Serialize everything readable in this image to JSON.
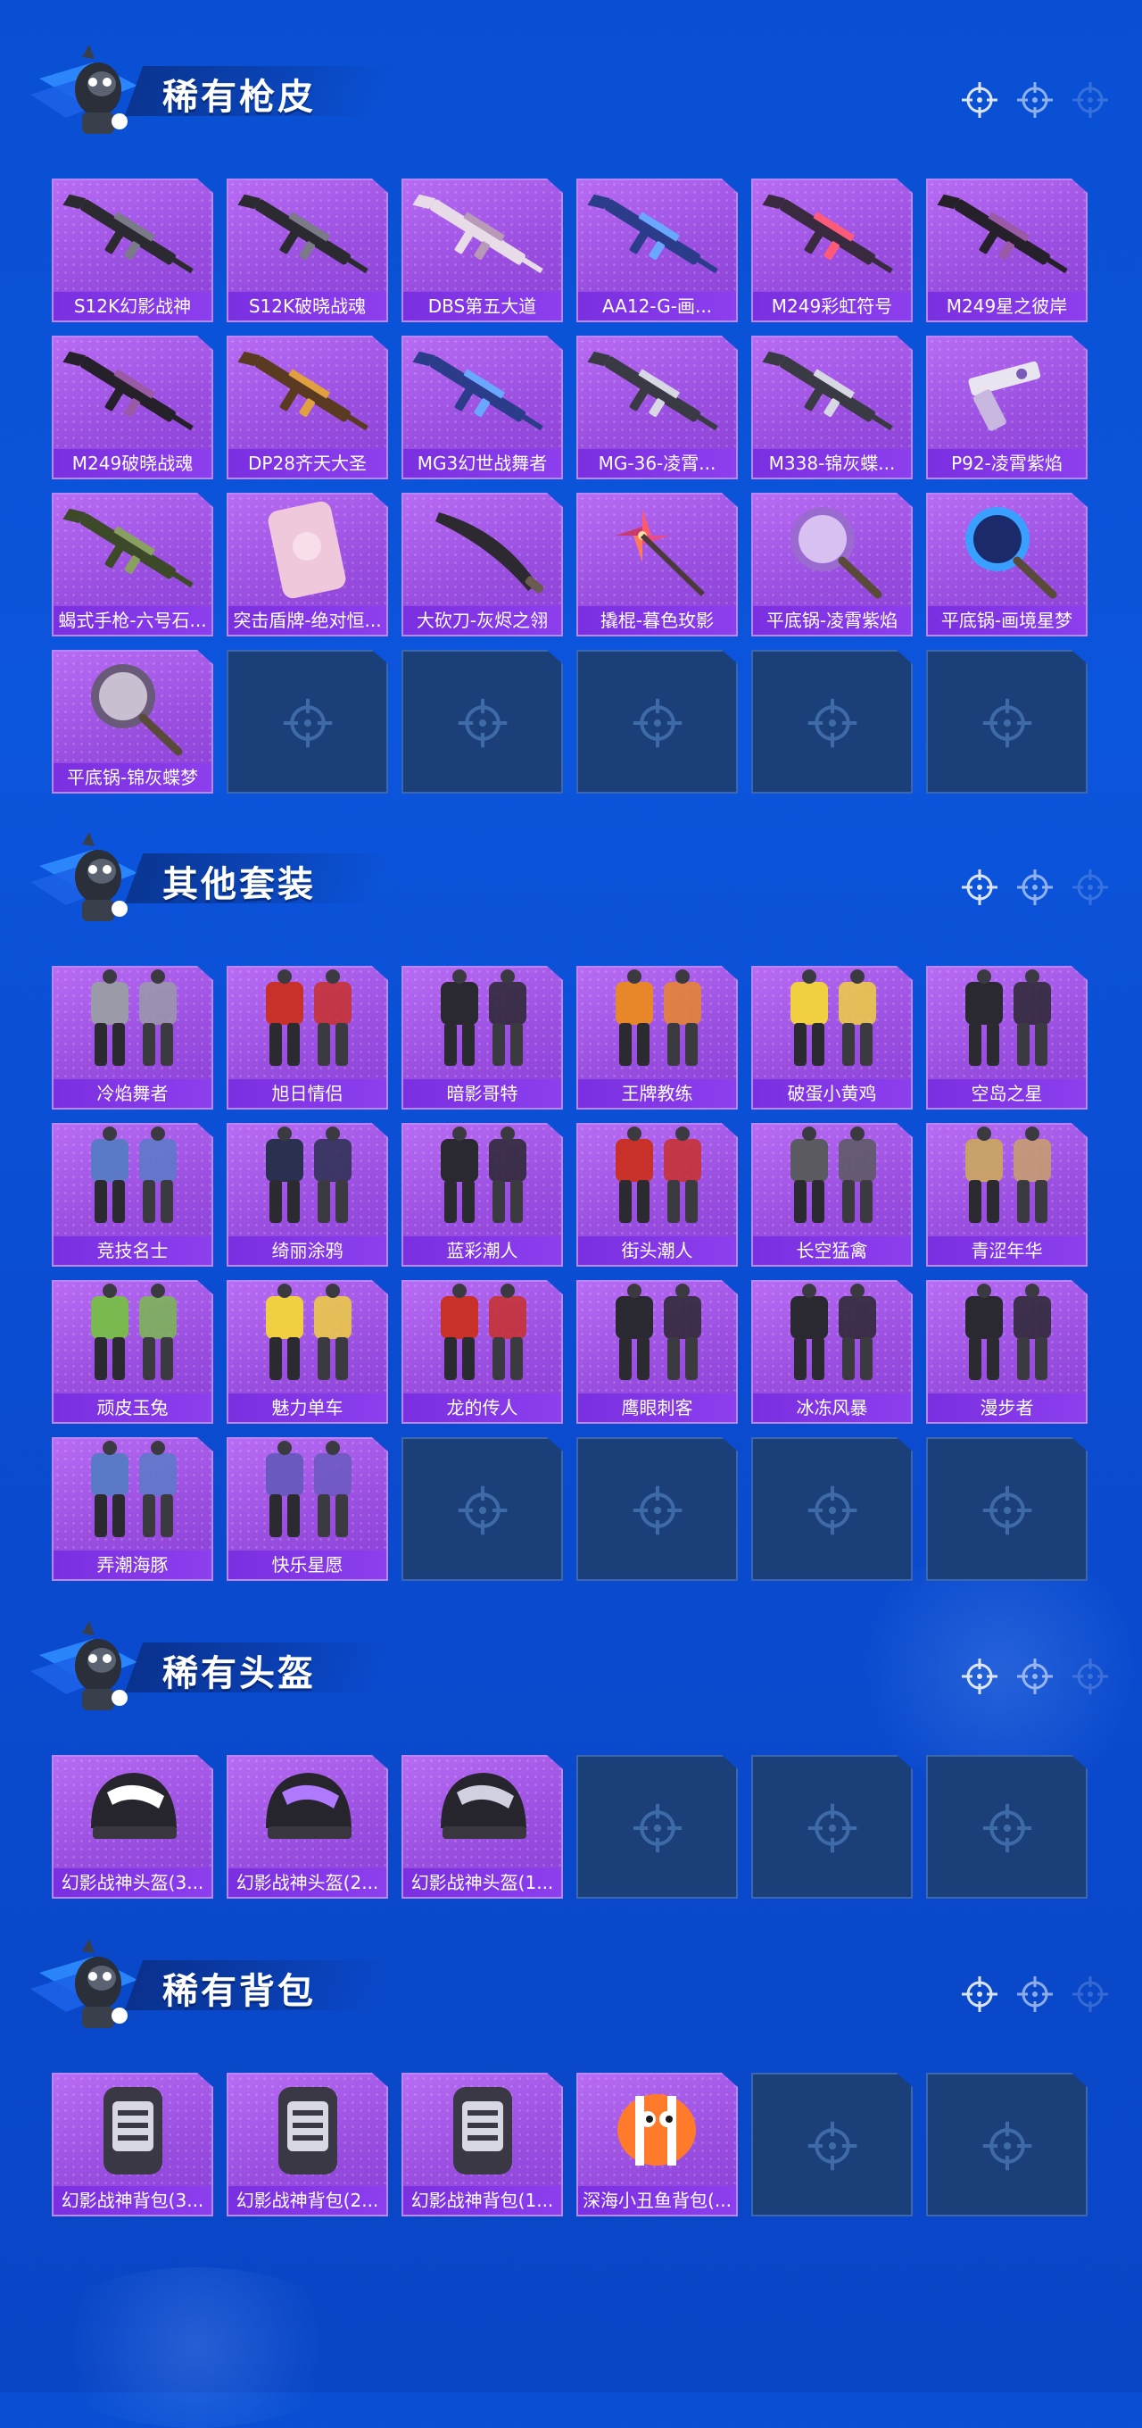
{
  "sections": [
    {
      "title": "稀有枪皮",
      "items": [
        {
          "label": "S12K幻影战神",
          "art": "shotgun"
        },
        {
          "label": "S12K破晓战魂",
          "art": "shotgun"
        },
        {
          "label": "DBS第五大道",
          "art": "shotgun-pink"
        },
        {
          "label": "AA12-G-画...",
          "art": "rifle-blue"
        },
        {
          "label": "M249彩虹符号",
          "art": "rifle-red"
        },
        {
          "label": "M249星之彼岸",
          "art": "rifle-dark"
        },
        {
          "label": "M249破晓战魂",
          "art": "rifle-dark"
        },
        {
          "label": "DP28齐天大圣",
          "art": "rifle-gold"
        },
        {
          "label": "MG3幻世战舞者",
          "art": "rifle-blue"
        },
        {
          "label": "MG-36-凌霄...",
          "art": "rifle-white"
        },
        {
          "label": "M338-锦灰蝶...",
          "art": "rifle-white"
        },
        {
          "label": "P92-凌霄紫焰",
          "art": "pistol"
        },
        {
          "label": "蝎式手枪-六号石...",
          "art": "smg"
        },
        {
          "label": "突击盾牌-绝对恒...",
          "art": "shield"
        },
        {
          "label": "大砍刀-灰烬之翎",
          "art": "machete"
        },
        {
          "label": "撬棍-暮色玫影",
          "art": "pinwheel"
        },
        {
          "label": "平底锅-凌霄紫焰",
          "art": "pan-purple"
        },
        {
          "label": "平底锅-画境星梦",
          "art": "pan-blue"
        },
        {
          "label": "平底锅-锦灰蝶梦",
          "art": "pan-grey"
        }
      ],
      "slots": 24
    },
    {
      "title": "其他套装",
      "items": [
        {
          "label": "冷焰舞者",
          "art": "outfit-grey"
        },
        {
          "label": "旭日情侣",
          "art": "outfit-red"
        },
        {
          "label": "暗影哥特",
          "art": "outfit-black"
        },
        {
          "label": "王牌教练",
          "art": "outfit-orange"
        },
        {
          "label": "破蛋小黄鸡",
          "art": "outfit-yellow"
        },
        {
          "label": "空岛之星",
          "art": "outfit-black"
        },
        {
          "label": "竞技名士",
          "art": "outfit-blue"
        },
        {
          "label": "绮丽涂鸦",
          "art": "outfit-navy"
        },
        {
          "label": "蓝彩潮人",
          "art": "outfit-black"
        },
        {
          "label": "街头潮人",
          "art": "outfit-red"
        },
        {
          "label": "长空猛禽",
          "art": "outfit-camo"
        },
        {
          "label": "青涩年华",
          "art": "outfit-tan"
        },
        {
          "label": "顽皮玉兔",
          "art": "outfit-green"
        },
        {
          "label": "魅力单车",
          "art": "outfit-yellow"
        },
        {
          "label": "龙的传人",
          "art": "outfit-red"
        },
        {
          "label": "鹰眼刺客",
          "art": "outfit-black"
        },
        {
          "label": "冰冻风暴",
          "art": "outfit-black"
        },
        {
          "label": "漫步者",
          "art": "outfit-black"
        },
        {
          "label": "弄潮海豚",
          "art": "outfit-blue"
        },
        {
          "label": "快乐星愿",
          "art": "outfit-purple"
        }
      ],
      "slots": 24
    },
    {
      "title": "稀有头盔",
      "items": [
        {
          "label": "幻影战神头盔(3...",
          "art": "helmet-3"
        },
        {
          "label": "幻影战神头盔(2...",
          "art": "helmet-2"
        },
        {
          "label": "幻影战神头盔(1...",
          "art": "helmet-1"
        }
      ],
      "slots": 6
    },
    {
      "title": "稀有背包",
      "items": [
        {
          "label": "幻影战神背包(3...",
          "art": "backpack"
        },
        {
          "label": "幻影战神背包(2...",
          "art": "backpack"
        },
        {
          "label": "幻影战神背包(1...",
          "art": "backpack"
        },
        {
          "label": "深海小丑鱼背包(...",
          "art": "clownfish"
        }
      ],
      "slots": 6
    }
  ],
  "colors": {
    "tile_purple": "#9a4fe0",
    "caption_purple": "#8d3fee",
    "empty_tile": "#1a3f79",
    "background_blue": "#0a4fd3"
  },
  "icons": {
    "crosshair": "crosshair-icon",
    "empty_slot": "crosshair-icon"
  }
}
